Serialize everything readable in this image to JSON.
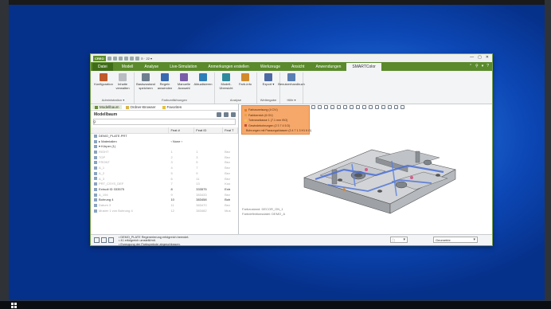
{
  "app": {
    "logo": "CREO",
    "title_suffix": "⊙ · 22 ▾",
    "window_controls": [
      "—",
      "▢",
      "✕"
    ],
    "ribbon_controls": [
      "⌃",
      "⚲",
      "▾",
      "?"
    ]
  },
  "tabs": [
    {
      "label": "Datei",
      "kind": "file"
    },
    {
      "label": "Modell"
    },
    {
      "label": "Analyse"
    },
    {
      "label": "Live-Simulation"
    },
    {
      "label": "Anmerkungen erstellen"
    },
    {
      "label": "Werkzeuge"
    },
    {
      "label": "Ansicht"
    },
    {
      "label": "Anwendungen"
    },
    {
      "label": "SMARTColor",
      "active": true
    }
  ],
  "ribbon": {
    "groups": [
      {
        "label": "Administration ▾",
        "buttons": [
          {
            "label": "Konfiguration",
            "color": "#c05b2a"
          },
          {
            "label": "Inhalte verwalten",
            "color": "#b9bdc2"
          }
        ]
      },
      {
        "label": "Farbumfärbungen",
        "buttons": [
          {
            "label": "Basiszustand speichern",
            "color": "#6f7f8e"
          },
          {
            "label": "Regeln anwenden",
            "color": "#3a6bb0"
          },
          {
            "label": "Manuelle Auswahl",
            "color": "#7a5fa8"
          },
          {
            "label": "Aktualisieren",
            "color": "#2e7fb8"
          }
        ]
      },
      {
        "label": "Analyse",
        "buttons": [
          {
            "label": "Modell-Übersicht",
            "color": "#2f8b9c"
          },
          {
            "label": "Farb-info",
            "color": "#d18b2c"
          }
        ]
      },
      {
        "label": "Weitergabe",
        "buttons": [
          {
            "label": "Export ▾",
            "color": "#4b6aa3"
          }
        ]
      },
      {
        "label": "Hilfe ▾",
        "buttons": [
          {
            "label": "Benutzerhandbuch",
            "color": "#5a7fb3"
          }
        ]
      }
    ]
  },
  "left_panel": {
    "tabs": [
      "Modellbaum",
      "Ordner-Browser",
      "Favoriten"
    ],
    "header": "Modellbaum",
    "columns": [
      "",
      "Feat #",
      "Feat ID",
      "Feat T"
    ],
    "rows": [
      {
        "name": "DEMO_PLATE.PRT",
        "feat": "",
        "id": "",
        "type": "",
        "style": ""
      },
      {
        "name": "▸ Materialien",
        "feat": "‹ None ›",
        "id": "",
        "type": "",
        "style": ""
      },
      {
        "name": "▾ Körper (1)",
        "feat": "",
        "id": "",
        "type": "",
        "style": ""
      },
      {
        "name": "RIGHT",
        "feat": "1",
        "id": "1",
        "type": "Bez",
        "style": "dim"
      },
      {
        "name": "TOP",
        "feat": "2",
        "id": "3",
        "type": "Bez",
        "style": "dim"
      },
      {
        "name": "FRONT",
        "feat": "3",
        "id": "5",
        "type": "Bez",
        "style": "dim"
      },
      {
        "name": "A_1",
        "feat": "4",
        "id": "7",
        "type": "Bez",
        "style": "dim"
      },
      {
        "name": "A_2",
        "feat": "5",
        "id": "9",
        "type": "Bez",
        "style": "dim"
      },
      {
        "name": "A_3",
        "feat": "6",
        "id": "11",
        "type": "Bez",
        "style": "dim"
      },
      {
        "name": "PRT_CSYS_DEF",
        "feat": "7",
        "id": "13",
        "type": "Koo",
        "style": "dim"
      },
      {
        "name": "Extrudi ID 333575",
        "feat": "8",
        "id": "333575",
        "type": "Extr",
        "style": ""
      },
      {
        "name": "A_194",
        "feat": "9",
        "id": "383433",
        "type": "Bez",
        "style": "dim"
      },
      {
        "name": "Bohrung 4",
        "feat": "10",
        "id": "383458",
        "type": "Boh",
        "style": ""
      },
      {
        "name": "Datum 3",
        "feat": "11",
        "id": "383470",
        "type": "Bez",
        "style": "dim"
      },
      {
        "name": "Muster 1 von Bohrung 4",
        "feat": "12",
        "id": "383482",
        "type": "Mus",
        "style": "dim"
      }
    ]
  },
  "view": {
    "legend": [
      {
        "label": "Farbzuweisung (4 C/V)",
        "color": "#e0801f"
      },
      {
        "label": "Farbbereich (6 GV)",
        "color": "#e8a13d"
      },
      {
        "label": "Toleranzklasse 1 (7.1 mm ISO)",
        "color": "#f0c24a"
      },
      {
        "label": "Gewindebohrungen (2 3 7 4 5 D)",
        "color": "#c84c2c"
      },
      {
        "label": "Bohrungen mit Passungsklassen (3 4 7 1 3 H1 6 G)",
        "color": "#d85a8a"
      }
    ],
    "captions": [
      "Farbzustand: DECOR_ON_1",
      "Farbdefinitionsdatei: DEMO_A"
    ]
  },
  "status": {
    "messages": [
      "• DEMO_PLATE Regenerierung erfolgreich beendet.",
      "• 41 erfolgreich umstellt/mit.",
      "• Erzeugung der Farbsymbole abgeschlossen."
    ],
    "selection_value": "Geometrie"
  },
  "colors": {
    "accent_green": "#5a8a2b",
    "legend_bg": "#f6a86a",
    "desktop_blue": "#1e66d1"
  }
}
